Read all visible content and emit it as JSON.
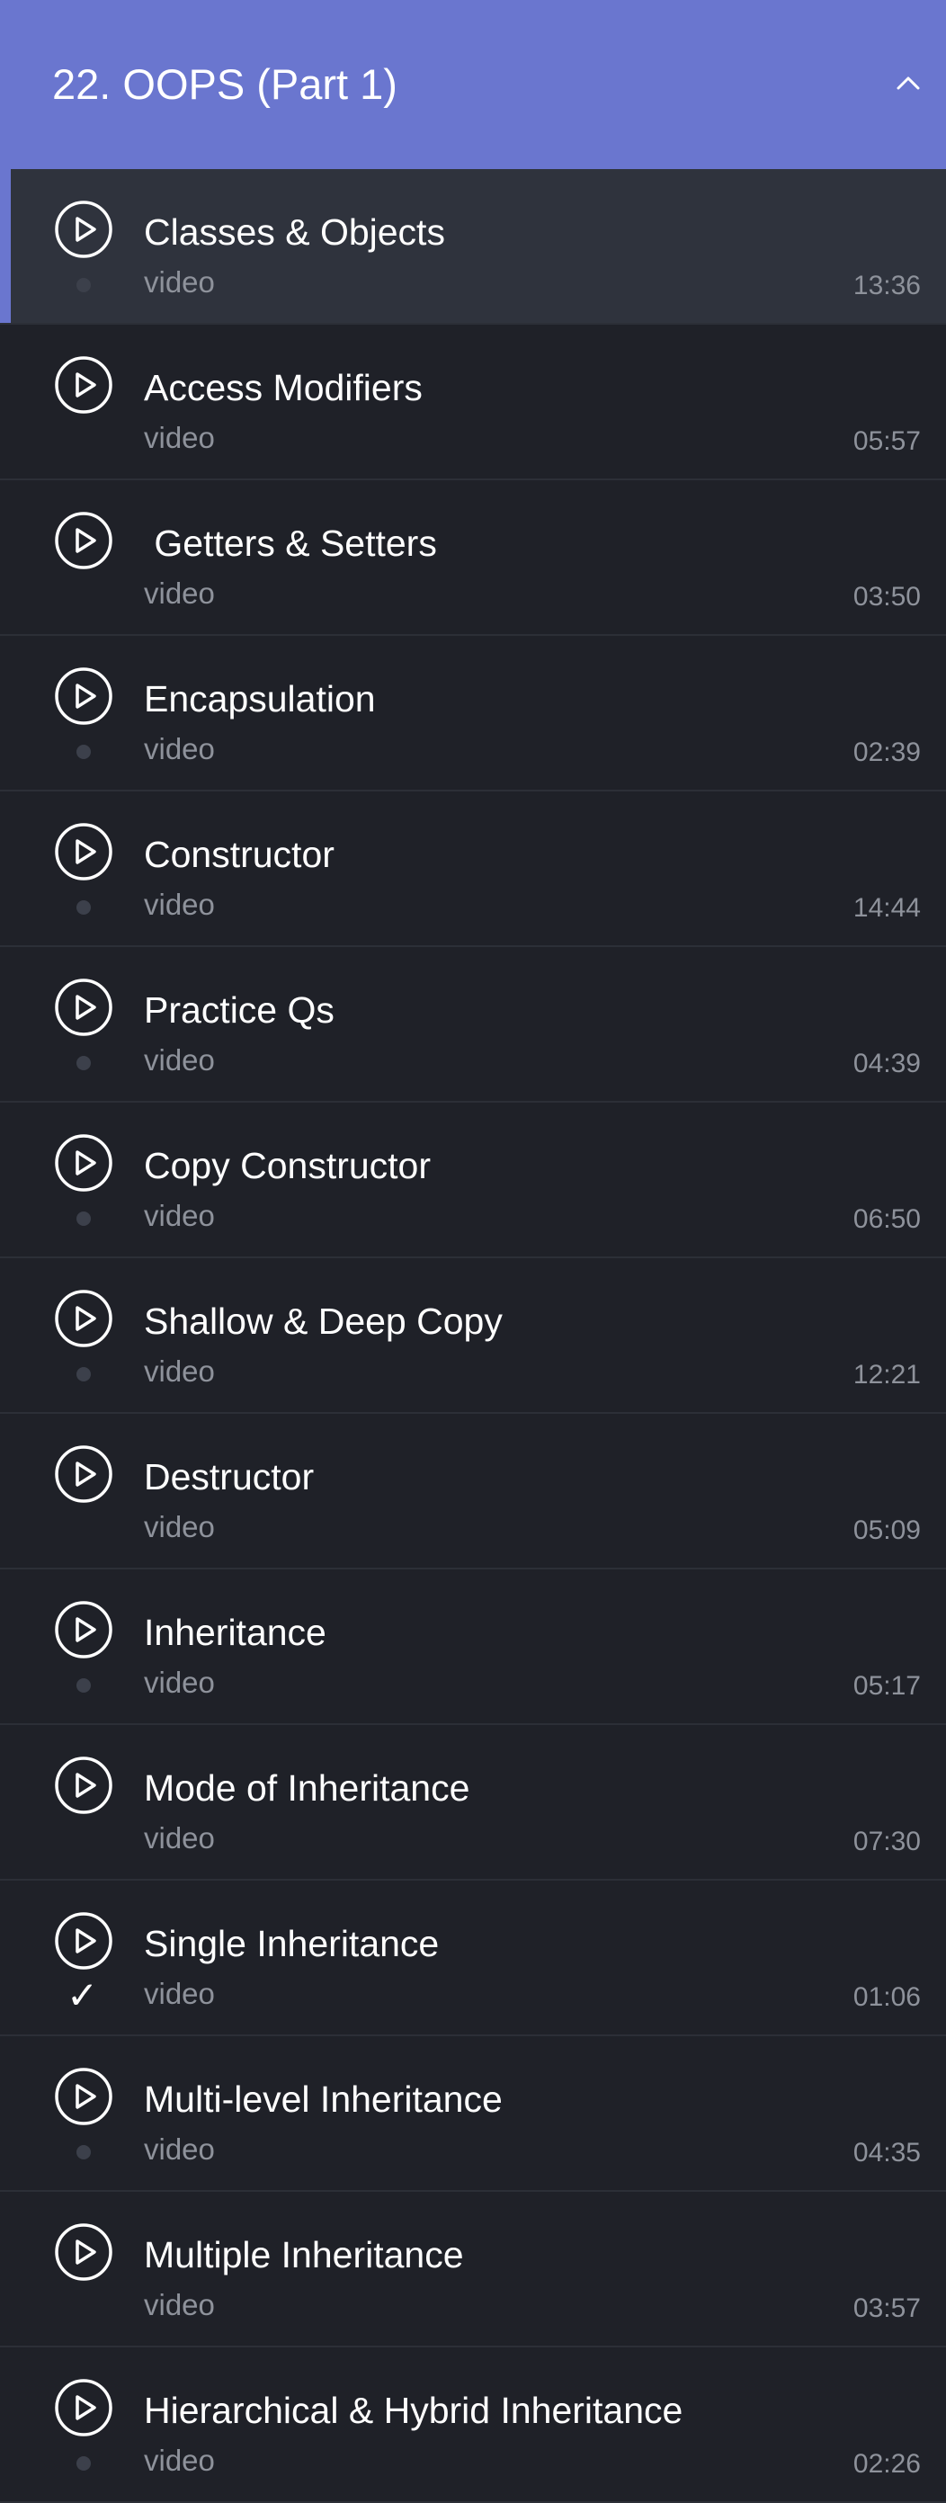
{
  "section": {
    "title": "22. OOPS (Part 1)",
    "collapse_icon": "chevron-up-icon"
  },
  "colors": {
    "header_bg": "#6a76cf",
    "accent": "#6a76cf",
    "list_bg": "#1f2128",
    "active_row_bg": "#2f333d",
    "muted_text": "#8e929b"
  },
  "lessons": [
    {
      "title": "Classes & Objects",
      "type": "video",
      "duration": "13:36",
      "status": "dot",
      "active": true
    },
    {
      "title": "Access Modifiers",
      "type": "video",
      "duration": "05:57",
      "status": "none",
      "active": false
    },
    {
      "title": " Getters & Setters",
      "type": "video",
      "duration": "03:50",
      "status": "none",
      "active": false
    },
    {
      "title": "Encapsulation",
      "type": "video",
      "duration": "02:39",
      "status": "dot",
      "active": false
    },
    {
      "title": "Constructor",
      "type": "video",
      "duration": "14:44",
      "status": "dot",
      "active": false
    },
    {
      "title": "Practice Qs",
      "type": "video",
      "duration": "04:39",
      "status": "dot",
      "active": false
    },
    {
      "title": "Copy Constructor",
      "type": "video",
      "duration": "06:50",
      "status": "dot",
      "active": false
    },
    {
      "title": "Shallow & Deep Copy",
      "type": "video",
      "duration": "12:21",
      "status": "dot",
      "active": false
    },
    {
      "title": "Destructor",
      "type": "video",
      "duration": "05:09",
      "status": "none",
      "active": false
    },
    {
      "title": "Inheritance",
      "type": "video",
      "duration": "05:17",
      "status": "dot",
      "active": false
    },
    {
      "title": "Mode of Inheritance",
      "type": "video",
      "duration": "07:30",
      "status": "none",
      "active": false
    },
    {
      "title": "Single Inheritance",
      "type": "video",
      "duration": "01:06",
      "status": "check",
      "active": false
    },
    {
      "title": "Multi-level Inheritance",
      "type": "video",
      "duration": "04:35",
      "status": "dot",
      "active": false
    },
    {
      "title": "Multiple Inheritance",
      "type": "video",
      "duration": "03:57",
      "status": "none",
      "active": false
    },
    {
      "title": "Hierarchical & Hybrid Inheritance",
      "type": "video",
      "duration": "02:26",
      "status": "dot",
      "active": false
    }
  ],
  "check_glyph": "✓"
}
